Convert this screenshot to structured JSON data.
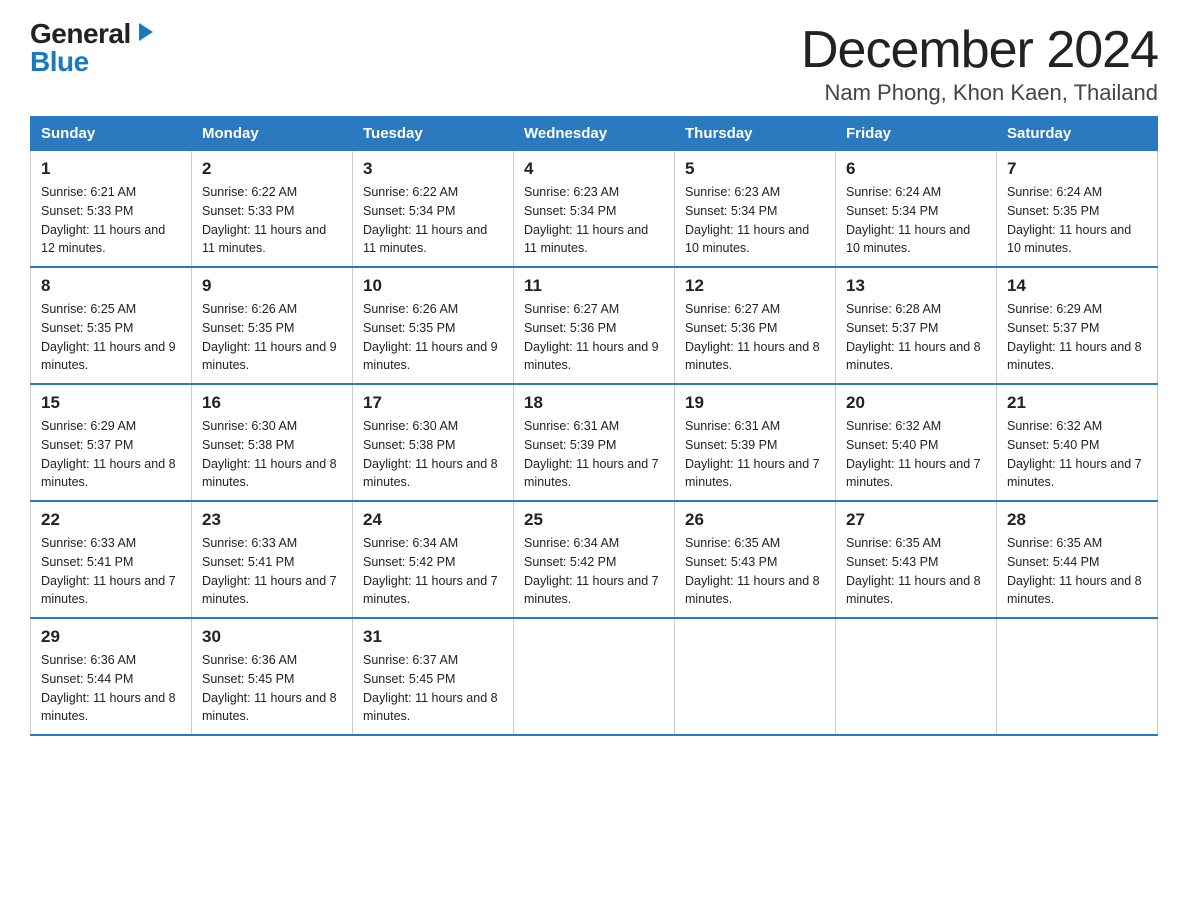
{
  "header": {
    "logo": {
      "general": "General",
      "triangle": "▶",
      "blue": "Blue"
    },
    "title": "December 2024",
    "location": "Nam Phong, Khon Kaen, Thailand"
  },
  "calendar": {
    "days_of_week": [
      "Sunday",
      "Monday",
      "Tuesday",
      "Wednesday",
      "Thursday",
      "Friday",
      "Saturday"
    ],
    "weeks": [
      [
        {
          "day": "1",
          "sunrise": "6:21 AM",
          "sunset": "5:33 PM",
          "daylight": "11 hours and 12 minutes."
        },
        {
          "day": "2",
          "sunrise": "6:22 AM",
          "sunset": "5:33 PM",
          "daylight": "11 hours and 11 minutes."
        },
        {
          "day": "3",
          "sunrise": "6:22 AM",
          "sunset": "5:34 PM",
          "daylight": "11 hours and 11 minutes."
        },
        {
          "day": "4",
          "sunrise": "6:23 AM",
          "sunset": "5:34 PM",
          "daylight": "11 hours and 11 minutes."
        },
        {
          "day": "5",
          "sunrise": "6:23 AM",
          "sunset": "5:34 PM",
          "daylight": "11 hours and 10 minutes."
        },
        {
          "day": "6",
          "sunrise": "6:24 AM",
          "sunset": "5:34 PM",
          "daylight": "11 hours and 10 minutes."
        },
        {
          "day": "7",
          "sunrise": "6:24 AM",
          "sunset": "5:35 PM",
          "daylight": "11 hours and 10 minutes."
        }
      ],
      [
        {
          "day": "8",
          "sunrise": "6:25 AM",
          "sunset": "5:35 PM",
          "daylight": "11 hours and 9 minutes."
        },
        {
          "day": "9",
          "sunrise": "6:26 AM",
          "sunset": "5:35 PM",
          "daylight": "11 hours and 9 minutes."
        },
        {
          "day": "10",
          "sunrise": "6:26 AM",
          "sunset": "5:35 PM",
          "daylight": "11 hours and 9 minutes."
        },
        {
          "day": "11",
          "sunrise": "6:27 AM",
          "sunset": "5:36 PM",
          "daylight": "11 hours and 9 minutes."
        },
        {
          "day": "12",
          "sunrise": "6:27 AM",
          "sunset": "5:36 PM",
          "daylight": "11 hours and 8 minutes."
        },
        {
          "day": "13",
          "sunrise": "6:28 AM",
          "sunset": "5:37 PM",
          "daylight": "11 hours and 8 minutes."
        },
        {
          "day": "14",
          "sunrise": "6:29 AM",
          "sunset": "5:37 PM",
          "daylight": "11 hours and 8 minutes."
        }
      ],
      [
        {
          "day": "15",
          "sunrise": "6:29 AM",
          "sunset": "5:37 PM",
          "daylight": "11 hours and 8 minutes."
        },
        {
          "day": "16",
          "sunrise": "6:30 AM",
          "sunset": "5:38 PM",
          "daylight": "11 hours and 8 minutes."
        },
        {
          "day": "17",
          "sunrise": "6:30 AM",
          "sunset": "5:38 PM",
          "daylight": "11 hours and 8 minutes."
        },
        {
          "day": "18",
          "sunrise": "6:31 AM",
          "sunset": "5:39 PM",
          "daylight": "11 hours and 7 minutes."
        },
        {
          "day": "19",
          "sunrise": "6:31 AM",
          "sunset": "5:39 PM",
          "daylight": "11 hours and 7 minutes."
        },
        {
          "day": "20",
          "sunrise": "6:32 AM",
          "sunset": "5:40 PM",
          "daylight": "11 hours and 7 minutes."
        },
        {
          "day": "21",
          "sunrise": "6:32 AM",
          "sunset": "5:40 PM",
          "daylight": "11 hours and 7 minutes."
        }
      ],
      [
        {
          "day": "22",
          "sunrise": "6:33 AM",
          "sunset": "5:41 PM",
          "daylight": "11 hours and 7 minutes."
        },
        {
          "day": "23",
          "sunrise": "6:33 AM",
          "sunset": "5:41 PM",
          "daylight": "11 hours and 7 minutes."
        },
        {
          "day": "24",
          "sunrise": "6:34 AM",
          "sunset": "5:42 PM",
          "daylight": "11 hours and 7 minutes."
        },
        {
          "day": "25",
          "sunrise": "6:34 AM",
          "sunset": "5:42 PM",
          "daylight": "11 hours and 7 minutes."
        },
        {
          "day": "26",
          "sunrise": "6:35 AM",
          "sunset": "5:43 PM",
          "daylight": "11 hours and 8 minutes."
        },
        {
          "day": "27",
          "sunrise": "6:35 AM",
          "sunset": "5:43 PM",
          "daylight": "11 hours and 8 minutes."
        },
        {
          "day": "28",
          "sunrise": "6:35 AM",
          "sunset": "5:44 PM",
          "daylight": "11 hours and 8 minutes."
        }
      ],
      [
        {
          "day": "29",
          "sunrise": "6:36 AM",
          "sunset": "5:44 PM",
          "daylight": "11 hours and 8 minutes."
        },
        {
          "day": "30",
          "sunrise": "6:36 AM",
          "sunset": "5:45 PM",
          "daylight": "11 hours and 8 minutes."
        },
        {
          "day": "31",
          "sunrise": "6:37 AM",
          "sunset": "5:45 PM",
          "daylight": "11 hours and 8 minutes."
        },
        null,
        null,
        null,
        null
      ]
    ]
  }
}
